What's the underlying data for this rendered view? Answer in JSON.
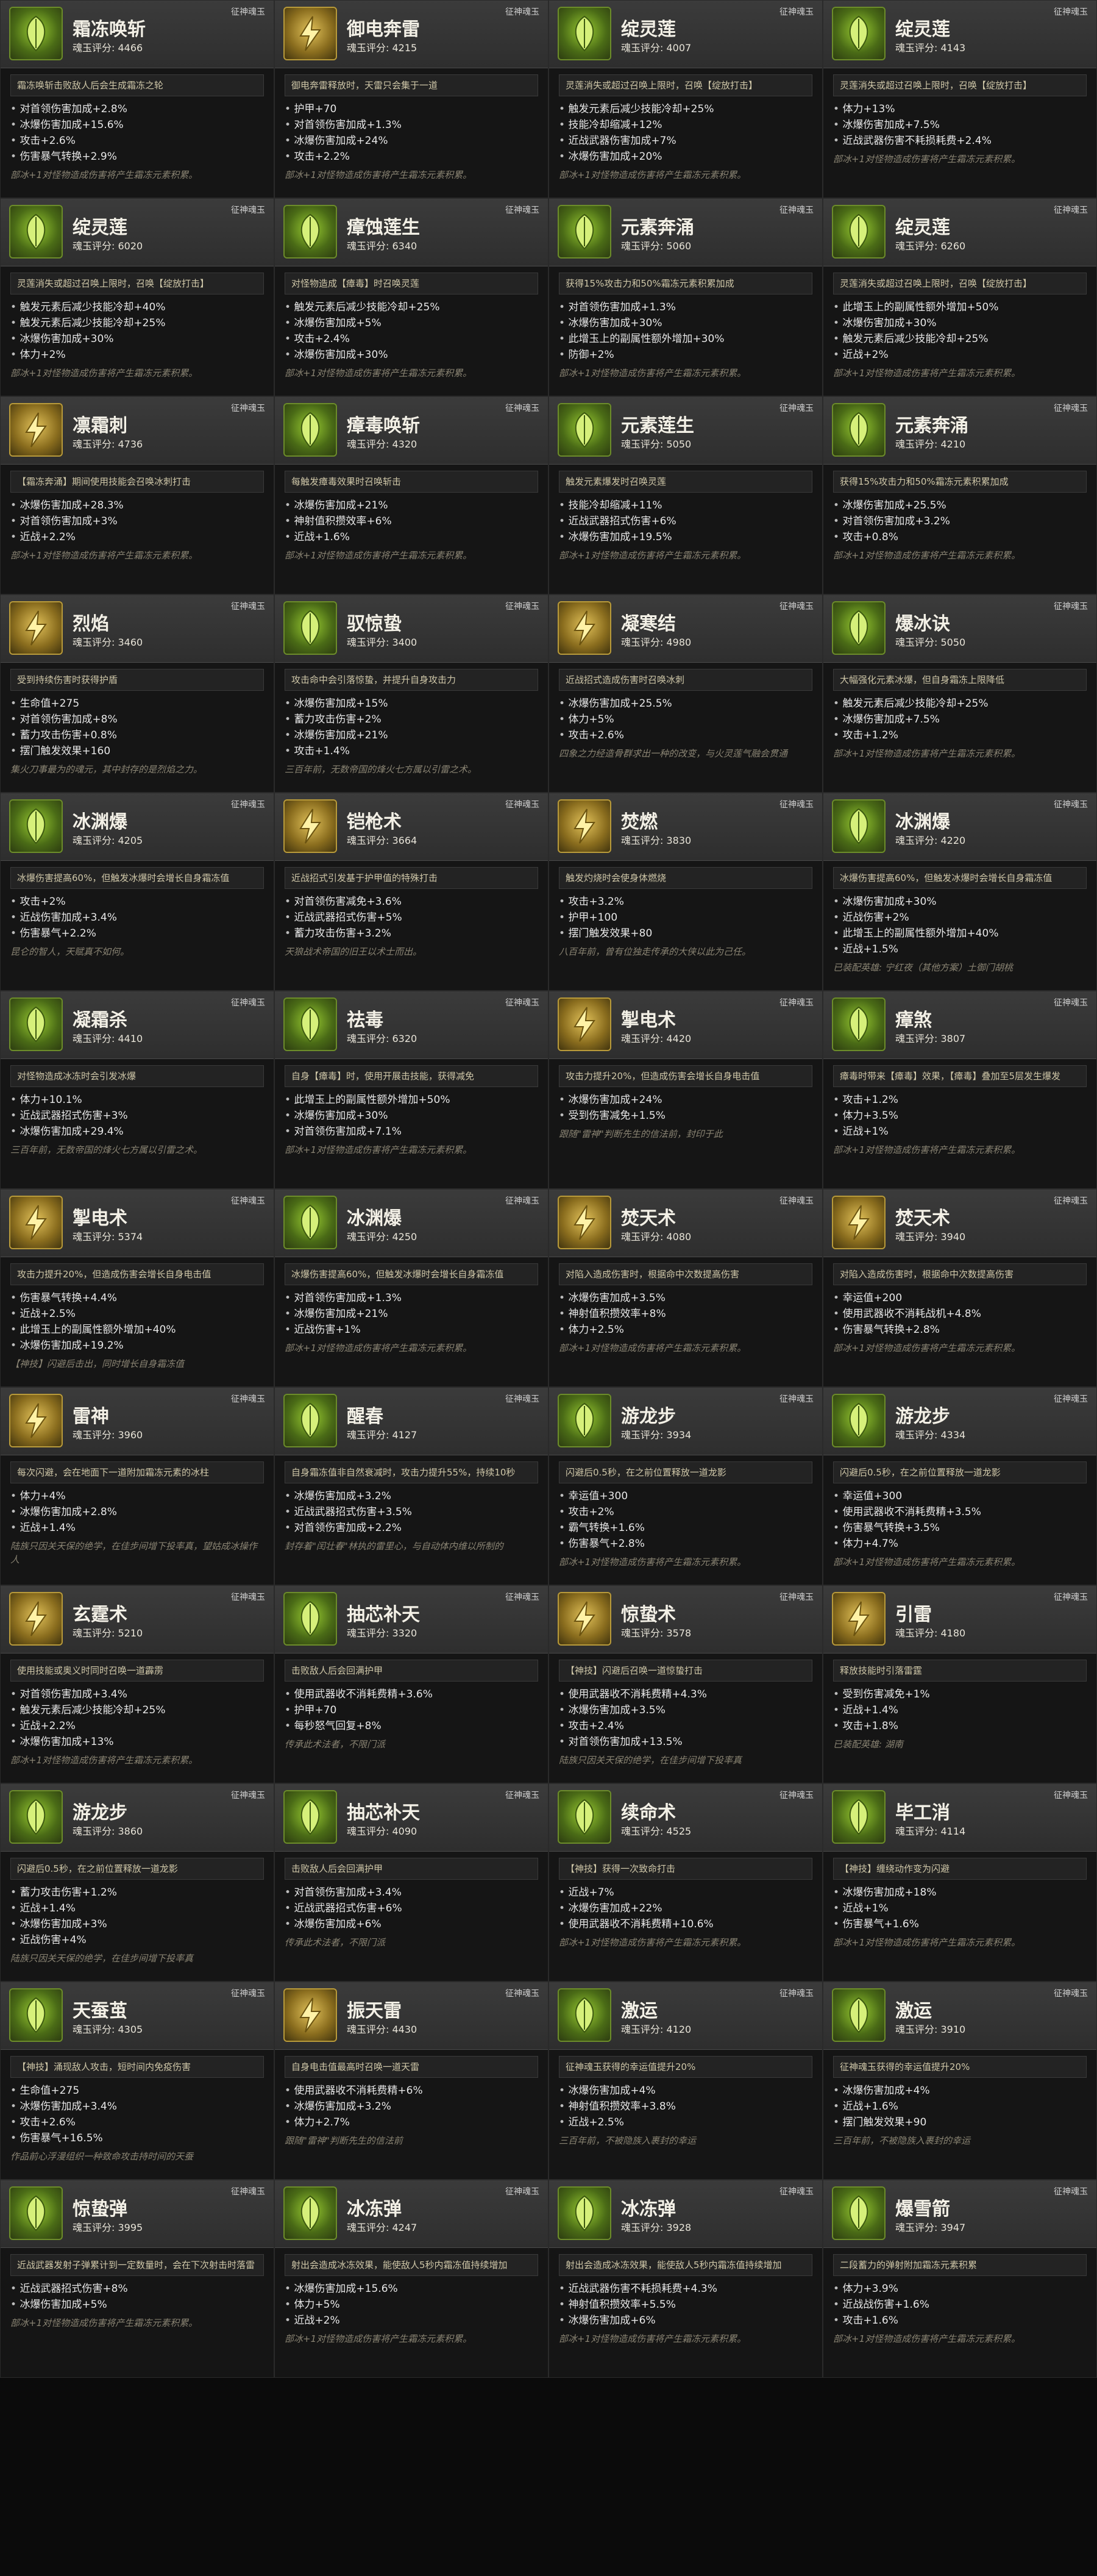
{
  "cards": [
    {
      "name": "霜冻唤斩",
      "tag": "征神魂玉",
      "score": "魂玉评分: 4466",
      "desc": "霜冻唤斩击败敌人后会生成霜冻之轮",
      "stats": [
        "对首领伤害加成+2.8%",
        "冰爆伤害加成+15.6%",
        "攻击+2.6%",
        "伤害暴气转换+2.9%"
      ],
      "flavor": "部冰+1对怪物造成伤害将产生霜冻元素积累。",
      "icon": "green"
    },
    {
      "name": "御电奔雷",
      "tag": "征神魂玉",
      "score": "魂玉评分: 4215",
      "desc": "御电奔雷释放时，天雷只会集于一道",
      "stats": [
        "护甲+70",
        "对首领伤害加成+1.3%",
        "冰爆伤害加成+24%",
        "攻击+2.2%"
      ],
      "flavor": "部冰+1对怪物造成伤害将产生霜冻元素积累。",
      "icon": "gold"
    },
    {
      "name": "绽灵莲",
      "tag": "征神魂玉",
      "score": "魂玉评分: 4007",
      "desc": "灵莲消失或超过召唤上限时，召唤【绽放打击】",
      "stats": [
        "触发元素后减少技能冷却+25%",
        "技能冷却缩减+12%",
        "近战武器伤害加成+7%",
        "冰爆伤害加成+20%"
      ],
      "flavor": "部冰+1对怪物造成伤害将产生霜冻元素积累。",
      "icon": "green"
    },
    {
      "name": "绽灵莲",
      "tag": "征神魂玉",
      "score": "魂玉评分: 4143",
      "desc": "灵莲消失或超过召唤上限时，召唤【绽放打击】",
      "stats": [
        "体力+13%",
        "冰爆伤害加成+7.5%",
        "近战武器伤害不耗损耗费+2.4%"
      ],
      "flavor": "部冰+1对怪物造成伤害将产生霜冻元素积累。",
      "icon": "green"
    },
    {
      "name": "绽灵莲",
      "tag": "征神魂玉",
      "score": "魂玉评分: 6020",
      "desc": "灵莲消失或超过召唤上限时，召唤【绽放打击】",
      "stats": [
        "触发元素后减少技能冷却+40%",
        "触发元素后减少技能冷却+25%",
        "冰爆伤害加成+30%",
        "体力+2%"
      ],
      "flavor": "部冰+1对怪物造成伤害将产生霜冻元素积累。",
      "icon": "green"
    },
    {
      "name": "瘴蚀莲生",
      "tag": "征神魂玉",
      "score": "魂玉评分: 6340",
      "desc": "对怪物造成【瘴毒】时召唤灵莲",
      "stats": [
        "触发元素后减少技能冷却+25%",
        "冰爆伤害加成+5%",
        "攻击+2.4%",
        "冰爆伤害加成+30%"
      ],
      "flavor": "部冰+1对怪物造成伤害将产生霜冻元素积累。",
      "icon": "green"
    },
    {
      "name": "元素奔涌",
      "tag": "征神魂玉",
      "score": "魂玉评分: 5060",
      "desc": "获得15%攻击力和50%霜冻元素积累加成",
      "stats": [
        "对首领伤害加成+1.3%",
        "冰爆伤害加成+30%",
        "此增玉上的副属性额外增加+30%",
        "防御+2%"
      ],
      "flavor": "部冰+1对怪物造成伤害将产生霜冻元素积累。",
      "icon": "green"
    },
    {
      "name": "绽灵莲",
      "tag": "征神魂玉",
      "score": "魂玉评分: 6260",
      "desc": "灵莲消失或超过召唤上限时，召唤【绽放打击】",
      "stats": [
        "此增玉上的副属性额外增加+50%",
        "冰爆伤害加成+30%",
        "触发元素后减少技能冷却+25%",
        "近战+2%"
      ],
      "flavor": "部冰+1对怪物造成伤害将产生霜冻元素积累。",
      "icon": "green"
    },
    {
      "name": "凛霜刺",
      "tag": "征神魂玉",
      "score": "魂玉评分: 4736",
      "desc": "【霜冻奔涌】期间使用技能会召唤冰刺打击",
      "stats": [
        "冰爆伤害加成+28.3%",
        "对首领伤害加成+3%",
        "近战+2.2%"
      ],
      "flavor": "部冰+1对怪物造成伤害将产生霜冻元素积累。",
      "icon": "gold"
    },
    {
      "name": "瘴毒唤斩",
      "tag": "征神魂玉",
      "score": "魂玉评分: 4320",
      "desc": "每触发瘴毒效果时召唤斩击",
      "stats": [
        "冰爆伤害加成+21%",
        "神射值积攒效率+6%",
        "近战+1.6%"
      ],
      "flavor": "部冰+1对怪物造成伤害将产生霜冻元素积累。",
      "icon": "green"
    },
    {
      "name": "元素莲生",
      "tag": "征神魂玉",
      "score": "魂玉评分: 5050",
      "desc": "触发元素爆发时召唤灵莲",
      "stats": [
        "技能冷却缩减+11%",
        "近战武器招式伤害+6%",
        "冰爆伤害加成+19.5%"
      ],
      "flavor": "部冰+1对怪物造成伤害将产生霜冻元素积累。",
      "icon": "green"
    },
    {
      "name": "元素奔涌",
      "tag": "征神魂玉",
      "score": "魂玉评分: 4210",
      "desc": "获得15%攻击力和50%霜冻元素积累加成",
      "stats": [
        "冰爆伤害加成+25.5%",
        "对首领伤害加成+3.2%",
        "攻击+0.8%"
      ],
      "flavor": "部冰+1对怪物造成伤害将产生霜冻元素积累。",
      "icon": "green"
    },
    {
      "name": "烈焰",
      "tag": "征神魂玉",
      "score": "魂玉评分: 3460",
      "desc": "受到持续伤害时获得护盾",
      "stats": [
        "生命值+275",
        "对首领伤害加成+8%",
        "蓄力攻击伤害+0.8%",
        "摆门触发效果+160"
      ],
      "flavor": "集火刀事最为的魂元，其中封存的是烈焰之力。",
      "icon": "gold"
    },
    {
      "name": "驭惊蛰",
      "tag": "征神魂玉",
      "score": "魂玉评分: 3400",
      "desc": "攻击命中会引落惊蛰，并提升自身攻击力",
      "stats": [
        "冰爆伤害加成+15%",
        "蓄力攻击伤害+2%",
        "冰爆伤害加成+21%",
        "攻击+1.4%"
      ],
      "flavor": "三百年前，无数帝国的烽火七方属以引雷之术。",
      "icon": "green"
    },
    {
      "name": "凝寒结",
      "tag": "征神魂玉",
      "score": "魂玉评分: 4980",
      "desc": "近战招式造成伤害时召唤冰刺",
      "stats": [
        "冰爆伤害加成+25.5%",
        "体力+5%",
        "攻击+2.6%"
      ],
      "flavor": "四象之力经造骨群求出一种的改变，与火灵莲气融会贯通",
      "icon": "gold"
    },
    {
      "name": "爆冰诀",
      "tag": "征神魂玉",
      "score": "魂玉评分: 5050",
      "desc": "大幅强化元素冰爆，但自身霜冻上限降低",
      "stats": [
        "触发元素后减少技能冷却+25%",
        "冰爆伤害加成+7.5%",
        "攻击+1.2%"
      ],
      "flavor": "部冰+1对怪物造成伤害将产生霜冻元素积累。",
      "icon": "green"
    },
    {
      "name": "冰渊爆",
      "tag": "征神魂玉",
      "score": "魂玉评分: 4205",
      "desc": "冰爆伤害提高60%，但触发冰爆时会增长自身霜冻值",
      "stats": [
        "攻击+2%",
        "近战伤害加成+3.4%",
        "伤害暴气+2.2%"
      ],
      "flavor": "昆仑的智人，天赋真不如何。",
      "icon": "green"
    },
    {
      "name": "铠枪术",
      "tag": "征神魂玉",
      "score": "魂玉评分: 3664",
      "desc": "近战招式引发基于护甲值的特殊打击",
      "stats": [
        "对首领伤害减免+3.6%",
        "近战武器招式伤害+5%",
        "蓄力攻击伤害+3.2%"
      ],
      "flavor": "天狼战术帝国的旧王以术士而出。",
      "icon": "gold"
    },
    {
      "name": "焚燃",
      "tag": "征神魂玉",
      "score": "魂玉评分: 3830",
      "desc": "触发灼烧时会使身体燃烧",
      "stats": [
        "攻击+3.2%",
        "护甲+100",
        "摆门触发效果+80"
      ],
      "flavor": "八百年前，曾有位独走传承的大侠以此为己任。",
      "icon": "gold"
    },
    {
      "name": "冰渊爆",
      "tag": "征神魂玉",
      "score": "魂玉评分: 4220",
      "desc": "冰爆伤害提高60%，但触发冰爆时会增长自身霜冻值",
      "stats": [
        "冰爆伤害加成+30%",
        "近战伤害+2%",
        "此增玉上的副属性额外增加+40%",
        "近战+1.5%"
      ],
      "flavor": "已装配英雄: 宁红夜（其他方案）土御门胡桃",
      "icon": "green"
    },
    {
      "name": "凝霜杀",
      "tag": "征神魂玉",
      "score": "魂玉评分: 4410",
      "desc": "对怪物造成冰冻时会引发冰爆",
      "stats": [
        "体力+10.1%",
        "近战武器招式伤害+3%",
        "冰爆伤害加成+29.4%"
      ],
      "flavor": "三百年前，无数帝国的烽火七方属以引雷之术。",
      "icon": "green"
    },
    {
      "name": "祛毒",
      "tag": "征神魂玉",
      "score": "魂玉评分: 6320",
      "desc": "自身【瘴毒】时，使用开展击技能，获得减免",
      "stats": [
        "此增玉上的副属性额外增加+50%",
        "冰爆伤害加成+30%",
        "对首领伤害加成+7.1%"
      ],
      "flavor": "部冰+1对怪物造成伤害将产生霜冻元素积累。",
      "icon": "green"
    },
    {
      "name": "掣电术",
      "tag": "征神魂玉",
      "score": "魂玉评分: 4420",
      "desc": "攻击力提升20%，但造成伤害会增长自身电击值",
      "stats": [
        "冰爆伤害加成+24%",
        "受到伤害减免+1.5%"
      ],
      "flavor": "跟随\"雷神\"判断先生的信法前，封印于此",
      "icon": "gold"
    },
    {
      "name": "瘴煞",
      "tag": "征神魂玉",
      "score": "魂玉评分: 3807",
      "desc": "瘴毒时带来【瘴毒】效果，【瘴毒】叠加至5层发生爆发",
      "stats": [
        "攻击+1.2%",
        "体力+3.5%",
        "近战+1%"
      ],
      "flavor": "部冰+1对怪物造成伤害将产生霜冻元素积累。",
      "icon": "green"
    },
    {
      "name": "掣电术",
      "tag": "征神魂玉",
      "score": "魂玉评分: 5374",
      "desc": "攻击力提升20%，但造成伤害会增长自身电击值",
      "stats": [
        "伤害暴气转换+4.4%",
        "近战+2.5%",
        "此增玉上的副属性额外增加+40%",
        "冰爆伤害加成+19.2%"
      ],
      "flavor": "【神技】闪避后击出，同时增长自身霜冻值",
      "icon": "gold"
    },
    {
      "name": "冰渊爆",
      "tag": "征神魂玉",
      "score": "魂玉评分: 4250",
      "desc": "冰爆伤害提高60%，但触发冰爆时会增长自身霜冻值",
      "stats": [
        "对首领伤害加成+1.3%",
        "冰爆伤害加成+21%",
        "近战伤害+1%"
      ],
      "flavor": "部冰+1对怪物造成伤害将产生霜冻元素积累。",
      "icon": "green"
    },
    {
      "name": "焚天术",
      "tag": "征神魂玉",
      "score": "魂玉评分: 4080",
      "desc": "对陷入造成伤害时，根据命中次数提高伤害",
      "stats": [
        "冰爆伤害加成+3.5%",
        "神射值积攒效率+8%",
        "体力+2.5%"
      ],
      "flavor": "部冰+1对怪物造成伤害将产生霜冻元素积累。",
      "icon": "gold"
    },
    {
      "name": "焚天术",
      "tag": "征神魂玉",
      "score": "魂玉评分: 3940",
      "desc": "对陷入造成伤害时，根据命中次数提高伤害",
      "stats": [
        "幸运值+200",
        "使用武器收不消耗战机+4.8%",
        "伤害暴气转换+2.8%"
      ],
      "flavor": "部冰+1对怪物造成伤害将产生霜冻元素积累。",
      "icon": "gold"
    },
    {
      "name": "雷神",
      "tag": "征神魂玉",
      "score": "魂玉评分: 3960",
      "desc": "每次闪避，会在地面下一道附加霜冻元素的冰柱",
      "stats": [
        "体力+4%",
        "冰爆伤害加成+2.8%",
        "近战+1.4%"
      ],
      "flavor": "陆族只因关天保的绝学，在佳步间增下投率真，望姑成冰操作人",
      "icon": "gold"
    },
    {
      "name": "醒春",
      "tag": "征神魂玉",
      "score": "魂玉评分: 4127",
      "desc": "自身霜冻值非自然衰减时，攻击力提升55%，持续10秒",
      "stats": [
        "冰爆伤害加成+3.2%",
        "近战武器招式伤害+3.5%",
        "对首领伤害加成+2.2%"
      ],
      "flavor": "封存着\"闰壮春\"林执的雷里心，与自动体内维以所制的",
      "icon": "green"
    },
    {
      "name": "游龙步",
      "tag": "征神魂玉",
      "score": "魂玉评分: 3934",
      "desc": "闪避后0.5秒，在之前位置释放一道龙影",
      "stats": [
        "幸运值+300",
        "攻击+2%",
        "霸气转换+1.6%",
        "伤害暴气+2.8%"
      ],
      "flavor": "部冰+1对怪物造成伤害将产生霜冻元素积累。",
      "icon": "green"
    },
    {
      "name": "游龙步",
      "tag": "征神魂玉",
      "score": "魂玉评分: 4334",
      "desc": "闪避后0.5秒，在之前位置释放一道龙影",
      "stats": [
        "幸运值+300",
        "使用武器收不消耗费精+3.5%",
        "伤害暴气转换+3.5%",
        "体力+4.7%"
      ],
      "flavor": "部冰+1对怪物造成伤害将产生霜冻元素积累。",
      "icon": "green"
    },
    {
      "name": "玄霆术",
      "tag": "征神魂玉",
      "score": "魂玉评分: 5210",
      "desc": "使用技能或奥义时同时召唤一道霹雳",
      "stats": [
        "对首领伤害加成+3.4%",
        "触发元素后减少技能冷却+25%",
        "近战+2.2%",
        "冰爆伤害加成+13%"
      ],
      "flavor": "部冰+1对怪物造成伤害将产生霜冻元素积累。",
      "icon": "gold"
    },
    {
      "name": "抽芯补天",
      "tag": "征神魂玉",
      "score": "魂玉评分: 3320",
      "desc": "击败敌人后会回满护甲",
      "stats": [
        "使用武器收不消耗费精+3.6%",
        "护甲+70",
        "每秒怒气回复+8%"
      ],
      "flavor": "传承此术法者，不限门派",
      "icon": "green"
    },
    {
      "name": "惊蛰术",
      "tag": "征神魂玉",
      "score": "魂玉评分: 3578",
      "desc": "【神技】闪避后召唤一道惊蛰打击",
      "stats": [
        "使用武器收不消耗费精+4.3%",
        "冰爆伤害加成+3.5%",
        "攻击+2.4%",
        "对首领伤害加成+13.5%"
      ],
      "flavor": "陆族只因关天保的绝学，在佳步间增下投率真",
      "icon": "gold"
    },
    {
      "name": "引雷",
      "tag": "征神魂玉",
      "score": "魂玉评分: 4180",
      "desc": "释放技能时引落雷霆",
      "stats": [
        "受到伤害减免+1%",
        "近战+1.4%",
        "攻击+1.8%"
      ],
      "flavor": "已装配英雄: 湖南",
      "icon": "gold"
    },
    {
      "name": "游龙步",
      "tag": "征神魂玉",
      "score": "魂玉评分: 3860",
      "desc": "闪避后0.5秒，在之前位置释放一道龙影",
      "stats": [
        "蓄力攻击伤害+1.2%",
        "近战+1.4%",
        "冰爆伤害加成+3%",
        "近战伤害+4%"
      ],
      "flavor": "陆族只因关天保的绝学，在佳步间增下投率真",
      "icon": "green"
    },
    {
      "name": "抽芯补天",
      "tag": "征神魂玉",
      "score": "魂玉评分: 4090",
      "desc": "击败敌人后会回满护甲",
      "stats": [
        "对首领伤害加成+3.4%",
        "近战武器招式伤害+6%",
        "冰爆伤害加成+6%"
      ],
      "flavor": "传承此术法者，不限门派",
      "icon": "green"
    },
    {
      "name": "续命术",
      "tag": "征神魂玉",
      "score": "魂玉评分: 4525",
      "desc": "【神技】获得一次致命打击",
      "stats": [
        "近战+7%",
        "冰爆伤害加成+22%",
        "使用武器收不消耗费精+10.6%"
      ],
      "flavor": "部冰+1对怪物造成伤害将产生霜冻元素积累。",
      "icon": "green"
    },
    {
      "name": "毕工消",
      "tag": "征神魂玉",
      "score": "魂玉评分: 4114",
      "desc": "【神技】缠绕动作变为闪避",
      "stats": [
        "冰爆伤害加成+18%",
        "近战+1%",
        "伤害暴气+1.6%"
      ],
      "flavor": "部冰+1对怪物造成伤害将产生霜冻元素积累。",
      "icon": "green"
    },
    {
      "name": "天蚕茧",
      "tag": "征神魂玉",
      "score": "魂玉评分: 4305",
      "desc": "【神技】涌现敌人攻击，短时间内免疫伤害",
      "stats": [
        "生命值+275",
        "冰爆伤害加成+3.4%",
        "攻击+2.6%",
        "伤害暴气+16.5%"
      ],
      "flavor": "作品前心浮漫组织一种致命攻击持时间的天蚕",
      "icon": "green"
    },
    {
      "name": "振天雷",
      "tag": "征神魂玉",
      "score": "魂玉评分: 4430",
      "desc": "自身电击值最高时召唤一道天雷",
      "stats": [
        "使用武器收不消耗费精+6%",
        "冰爆伤害加成+3.2%",
        "体力+2.7%"
      ],
      "flavor": "跟随\"雷神\"判断先生的信法前",
      "icon": "gold"
    },
    {
      "name": "激运",
      "tag": "征神魂玉",
      "score": "魂玉评分: 4120",
      "desc": "征神魂玉获得的幸运值提升20%",
      "stats": [
        "冰爆伤害加成+4%",
        "神射值积攒效率+3.8%",
        "近战+2.5%"
      ],
      "flavor": "三百年前，不被隐族入裹封的幸运",
      "icon": "green"
    },
    {
      "name": "激运",
      "tag": "征神魂玉",
      "score": "魂玉评分: 3910",
      "desc": "征神魂玉获得的幸运值提升20%",
      "stats": [
        "冰爆伤害加成+4%",
        "近战+1.6%",
        "摆门触发效果+90"
      ],
      "flavor": "三百年前，不被隐族入裹封的幸运",
      "icon": "green"
    },
    {
      "name": "惊蛰弹",
      "tag": "征神魂玉",
      "score": "魂玉评分: 3995",
      "desc": "近战武器发射子弹累计到一定数量时，会在下次射击时落雷",
      "stats": [
        "近战武器招式伤害+8%",
        "冰爆伤害加成+5%"
      ],
      "flavor": "部冰+1对怪物造成伤害将产生霜冻元素积累。",
      "icon": "green"
    },
    {
      "name": "冰冻弹",
      "tag": "征神魂玉",
      "score": "魂玉评分: 4247",
      "desc": "射出会造成冰冻效果，能使敌人5秒内霜冻值持续增加",
      "stats": [
        "冰爆伤害加成+15.6%",
        "体力+5%",
        "近战+2%"
      ],
      "flavor": "部冰+1对怪物造成伤害将产生霜冻元素积累。",
      "icon": "green"
    },
    {
      "name": "冰冻弹",
      "tag": "征神魂玉",
      "score": "魂玉评分: 3928",
      "desc": "射出会造成冰冻效果，能使敌人5秒内霜冻值持续增加",
      "stats": [
        "近战武器伤害不耗损耗费+4.3%",
        "神射值积攒效率+5.5%",
        "冰爆伤害加成+6%"
      ],
      "flavor": "部冰+1对怪物造成伤害将产生霜冻元素积累。",
      "icon": "green"
    },
    {
      "name": "爆雪箭",
      "tag": "征神魂玉",
      "score": "魂玉评分: 3947",
      "desc": "二段蓄力的弹射附加霜冻元素积累",
      "stats": [
        "体力+3.9%",
        "近战战伤害+1.6%",
        "攻击+1.6%"
      ],
      "flavor": "部冰+1对怪物造成伤害将产生霜冻元素积累。",
      "icon": "green"
    }
  ]
}
